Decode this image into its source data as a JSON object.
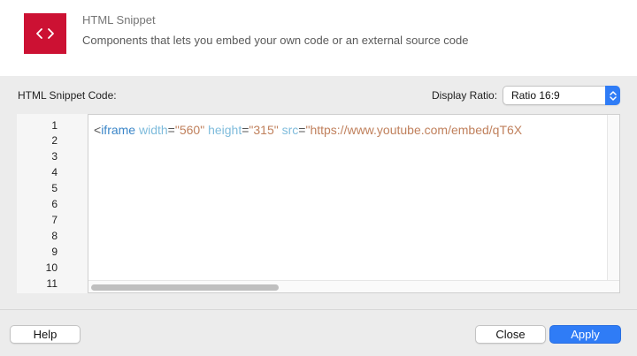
{
  "header": {
    "icon": "code-brackets-icon",
    "icon_color": "#cc1133",
    "title": "HTML Snippet",
    "subtitle": "Components that lets you embed your own code or an external source code"
  },
  "options": {
    "code_label": "HTML Snippet Code:",
    "ratio_label": "Display Ratio:",
    "ratio_value": "Ratio 16:9"
  },
  "editor": {
    "line_numbers": [
      "1",
      "2",
      "3",
      "4",
      "5",
      "6",
      "7",
      "8",
      "9",
      "10",
      "11"
    ],
    "code_tokens": {
      "open": "<",
      "tag": "iframe",
      "attr1": "width",
      "val1": "\"560\"",
      "attr2": "height",
      "val2": "\"315\"",
      "attr3": "src",
      "val3": "\"https://www.youtube.com/embed/qT6X"
    },
    "equals": "="
  },
  "footer": {
    "help_label": "Help",
    "close_label": "Close",
    "apply_label": "Apply",
    "accent_color": "#2f7cf6"
  }
}
